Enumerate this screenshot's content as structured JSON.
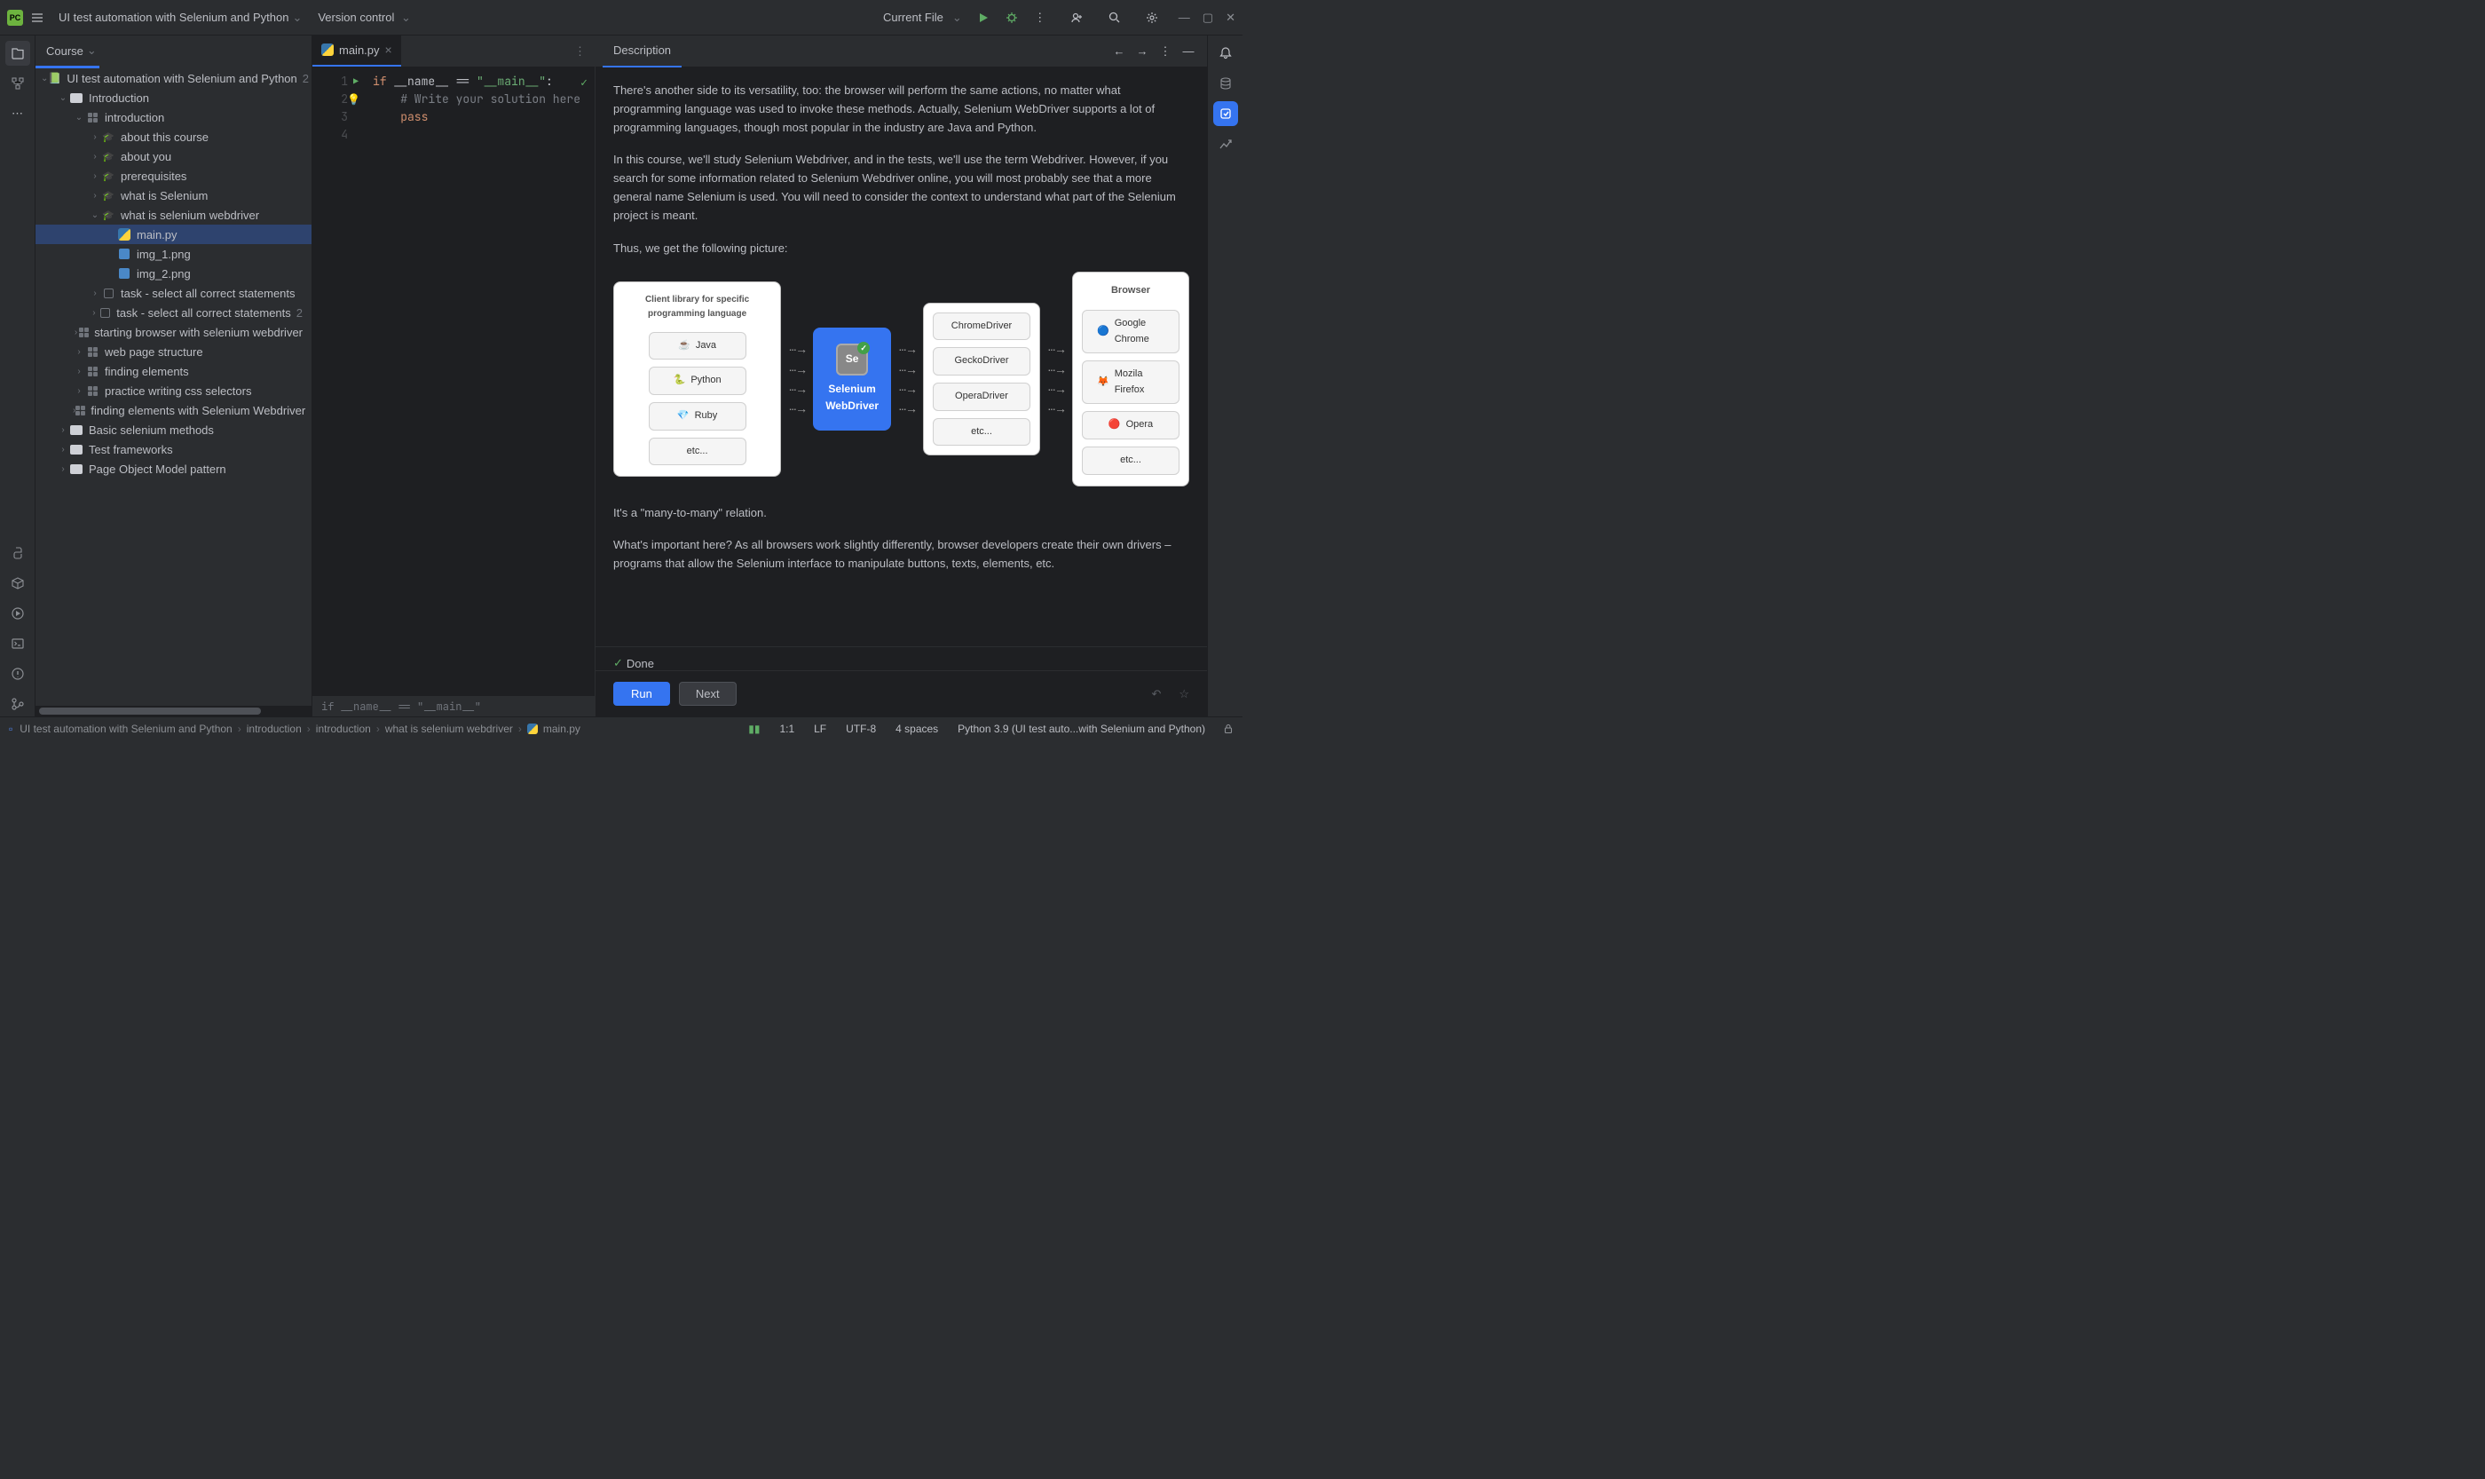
{
  "titlebar": {
    "project": "UI test automation with Selenium and Python",
    "vc": "Version control",
    "runconfig": "Current File"
  },
  "treeHeader": "Course",
  "tree": {
    "root": {
      "label": "UI test automation with Selenium and Python",
      "suffix": "2"
    },
    "intro": "Introduction",
    "introduction": "introduction",
    "aboutCourse": "about this course",
    "aboutYou": "about you",
    "prereq": "prerequisites",
    "whatSel": "what is Selenium",
    "whatSelWd": "what is selenium webdriver",
    "mainpy": "main.py",
    "img1": "img_1.png",
    "img2": "img_2.png",
    "task1": "task - select all correct statements",
    "task2": "task - select all correct statements",
    "task2suffix": "2",
    "starting": "starting browser with selenium webdriver",
    "webpage": "web page structure",
    "finding": "finding elements",
    "practice": "practice writing css selectors",
    "findingWd": "finding elements with Selenium Webdriver",
    "basic": "Basic selenium methods",
    "testfw": "Test frameworks",
    "pom": "Page Object Model pattern"
  },
  "editor": {
    "tab": "main.py",
    "lines": [
      "1",
      "2",
      "3",
      "4"
    ],
    "code1a": "if",
    "code1b": " __name__ == ",
    "code1c": "\"__main__\"",
    "code1d": ":",
    "code2": "    # Write your solution here",
    "code3": "    pass",
    "crumb": "if __name__ == \"__main__\""
  },
  "desc": {
    "tab": "Description",
    "p1": "There's another side to its versatility, too: the browser will perform the same actions, no matter what programming language was used to invoke these methods. Actually, Selenium WebDriver supports a lot of programming languages, though most popular in the industry are Java and Python.",
    "p2": "In this course, we'll study Selenium Webdriver, and in the tests, we'll use the term Webdriver. However, if you search for some information related to Selenium Webdriver online, you will most probably see that a more general name Selenium is used. You will need to consider the context to understand what part of the Selenium project is meant.",
    "p3": "Thus, we get the following picture:",
    "p4": "It's a \"many-to-many\" relation.",
    "p5": "What's important here? As all browsers work slightly differently, browser developers create their own drivers – programs that allow the Selenium interface to manipulate buttons, texts, elements, etc.",
    "done": "Done",
    "run": "Run",
    "next": "Next",
    "diag": {
      "clientTitle": "Client library for specific programming language",
      "langs": [
        "Java",
        "Python",
        "Ruby",
        "etc..."
      ],
      "seL1": "Selenium",
      "seL2": "WebDriver",
      "drivers": [
        "ChromeDriver",
        "GeckoDriver",
        "OperaDriver",
        "etc..."
      ],
      "browserTitle": "Browser",
      "browsers": [
        "Google Chrome",
        "Mozila Firefox",
        "Opera",
        "etc..."
      ]
    }
  },
  "status": {
    "crumb": [
      "UI test automation with Selenium and Python",
      "introduction",
      "introduction",
      "what is selenium webdriver",
      "main.py"
    ],
    "pos": "1:1",
    "sep": "LF",
    "enc": "UTF-8",
    "indent": "4 spaces",
    "py": "Python 3.9 (UI test auto...with Selenium and Python)"
  }
}
